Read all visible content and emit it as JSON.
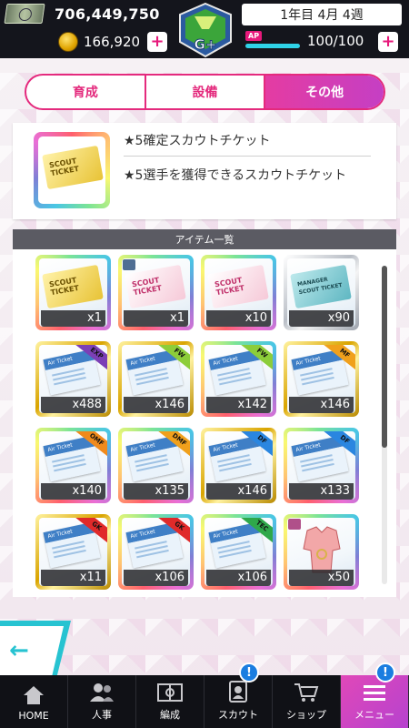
{
  "header": {
    "money": "706,449,750",
    "coins": "166,920",
    "team_grade": "G+",
    "date": "1年目 4月 4週",
    "ap_label": "AP",
    "ap": "100/100",
    "ap_fraction": 1.0,
    "plus": "+"
  },
  "tabs": [
    {
      "label": "育成",
      "active": false
    },
    {
      "label": "設備",
      "active": false
    },
    {
      "label": "その他",
      "active": true
    }
  ],
  "detail": {
    "name": "★5確定スカウトチケット",
    "description": "★5選手を獲得できるスカウトチケット"
  },
  "list": {
    "title": "アイテム一覧",
    "items": [
      {
        "kind": "scout-gold",
        "label": "SCOUT TICKET",
        "count": "x1",
        "frame": "rainbow"
      },
      {
        "kind": "scout-pink",
        "label": "SCOUT TICKET",
        "count": "x1",
        "frame": "rainbow"
      },
      {
        "kind": "scout-pink",
        "label": "SCOUT TICKET",
        "count": "x10",
        "frame": "rainbow"
      },
      {
        "kind": "manager",
        "label": "MANAGER SCOUT TICKET",
        "count": "x90",
        "frame": "silver"
      },
      {
        "kind": "air",
        "tag": "EXP",
        "count": "x488",
        "frame": "gold"
      },
      {
        "kind": "air",
        "tag": "FW",
        "count": "x146",
        "frame": "gold"
      },
      {
        "kind": "air",
        "tag": "FW",
        "count": "x142",
        "frame": "rainbow"
      },
      {
        "kind": "air",
        "tag": "MF",
        "count": "x146",
        "frame": "gold"
      },
      {
        "kind": "air",
        "tag": "OMF",
        "count": "x140",
        "frame": "rainbow"
      },
      {
        "kind": "air",
        "tag": "DMF",
        "count": "x135",
        "frame": "rainbow"
      },
      {
        "kind": "air",
        "tag": "DF",
        "count": "x146",
        "frame": "gold"
      },
      {
        "kind": "air",
        "tag": "DF",
        "count": "x133",
        "frame": "rainbow"
      },
      {
        "kind": "air",
        "tag": "GK",
        "count": "x11",
        "frame": "gold"
      },
      {
        "kind": "air",
        "tag": "GK",
        "count": "x106",
        "frame": "rainbow"
      },
      {
        "kind": "air",
        "tag": "TEC",
        "count": "x106",
        "frame": "rainbow"
      },
      {
        "kind": "costume",
        "count": "x50",
        "frame": "rainbow"
      }
    ],
    "ticket_word": "Air Ticket"
  },
  "nav": [
    {
      "label": "HOME",
      "icon": "home-icon"
    },
    {
      "label": "人事",
      "icon": "people-icon"
    },
    {
      "label": "編成",
      "icon": "formation-icon"
    },
    {
      "label": "スカウト",
      "icon": "scout-icon",
      "badge": "!"
    },
    {
      "label": "ショップ",
      "icon": "cart-icon"
    },
    {
      "label": "メニュー",
      "icon": "menu-icon",
      "badge": "!",
      "active": true
    }
  ],
  "colors": {
    "accent": "#e42a7d",
    "cyan": "#27c3d1",
    "tags": {
      "EXP": "#7b3fb6",
      "FW": "#8ccd3a",
      "MF": "#f0a01c",
      "OMF": "#f08a1c",
      "DMF": "#f0a01c",
      "DF": "#2a86e0",
      "GK": "#e02a2a",
      "TEC": "#2fa84a"
    }
  }
}
